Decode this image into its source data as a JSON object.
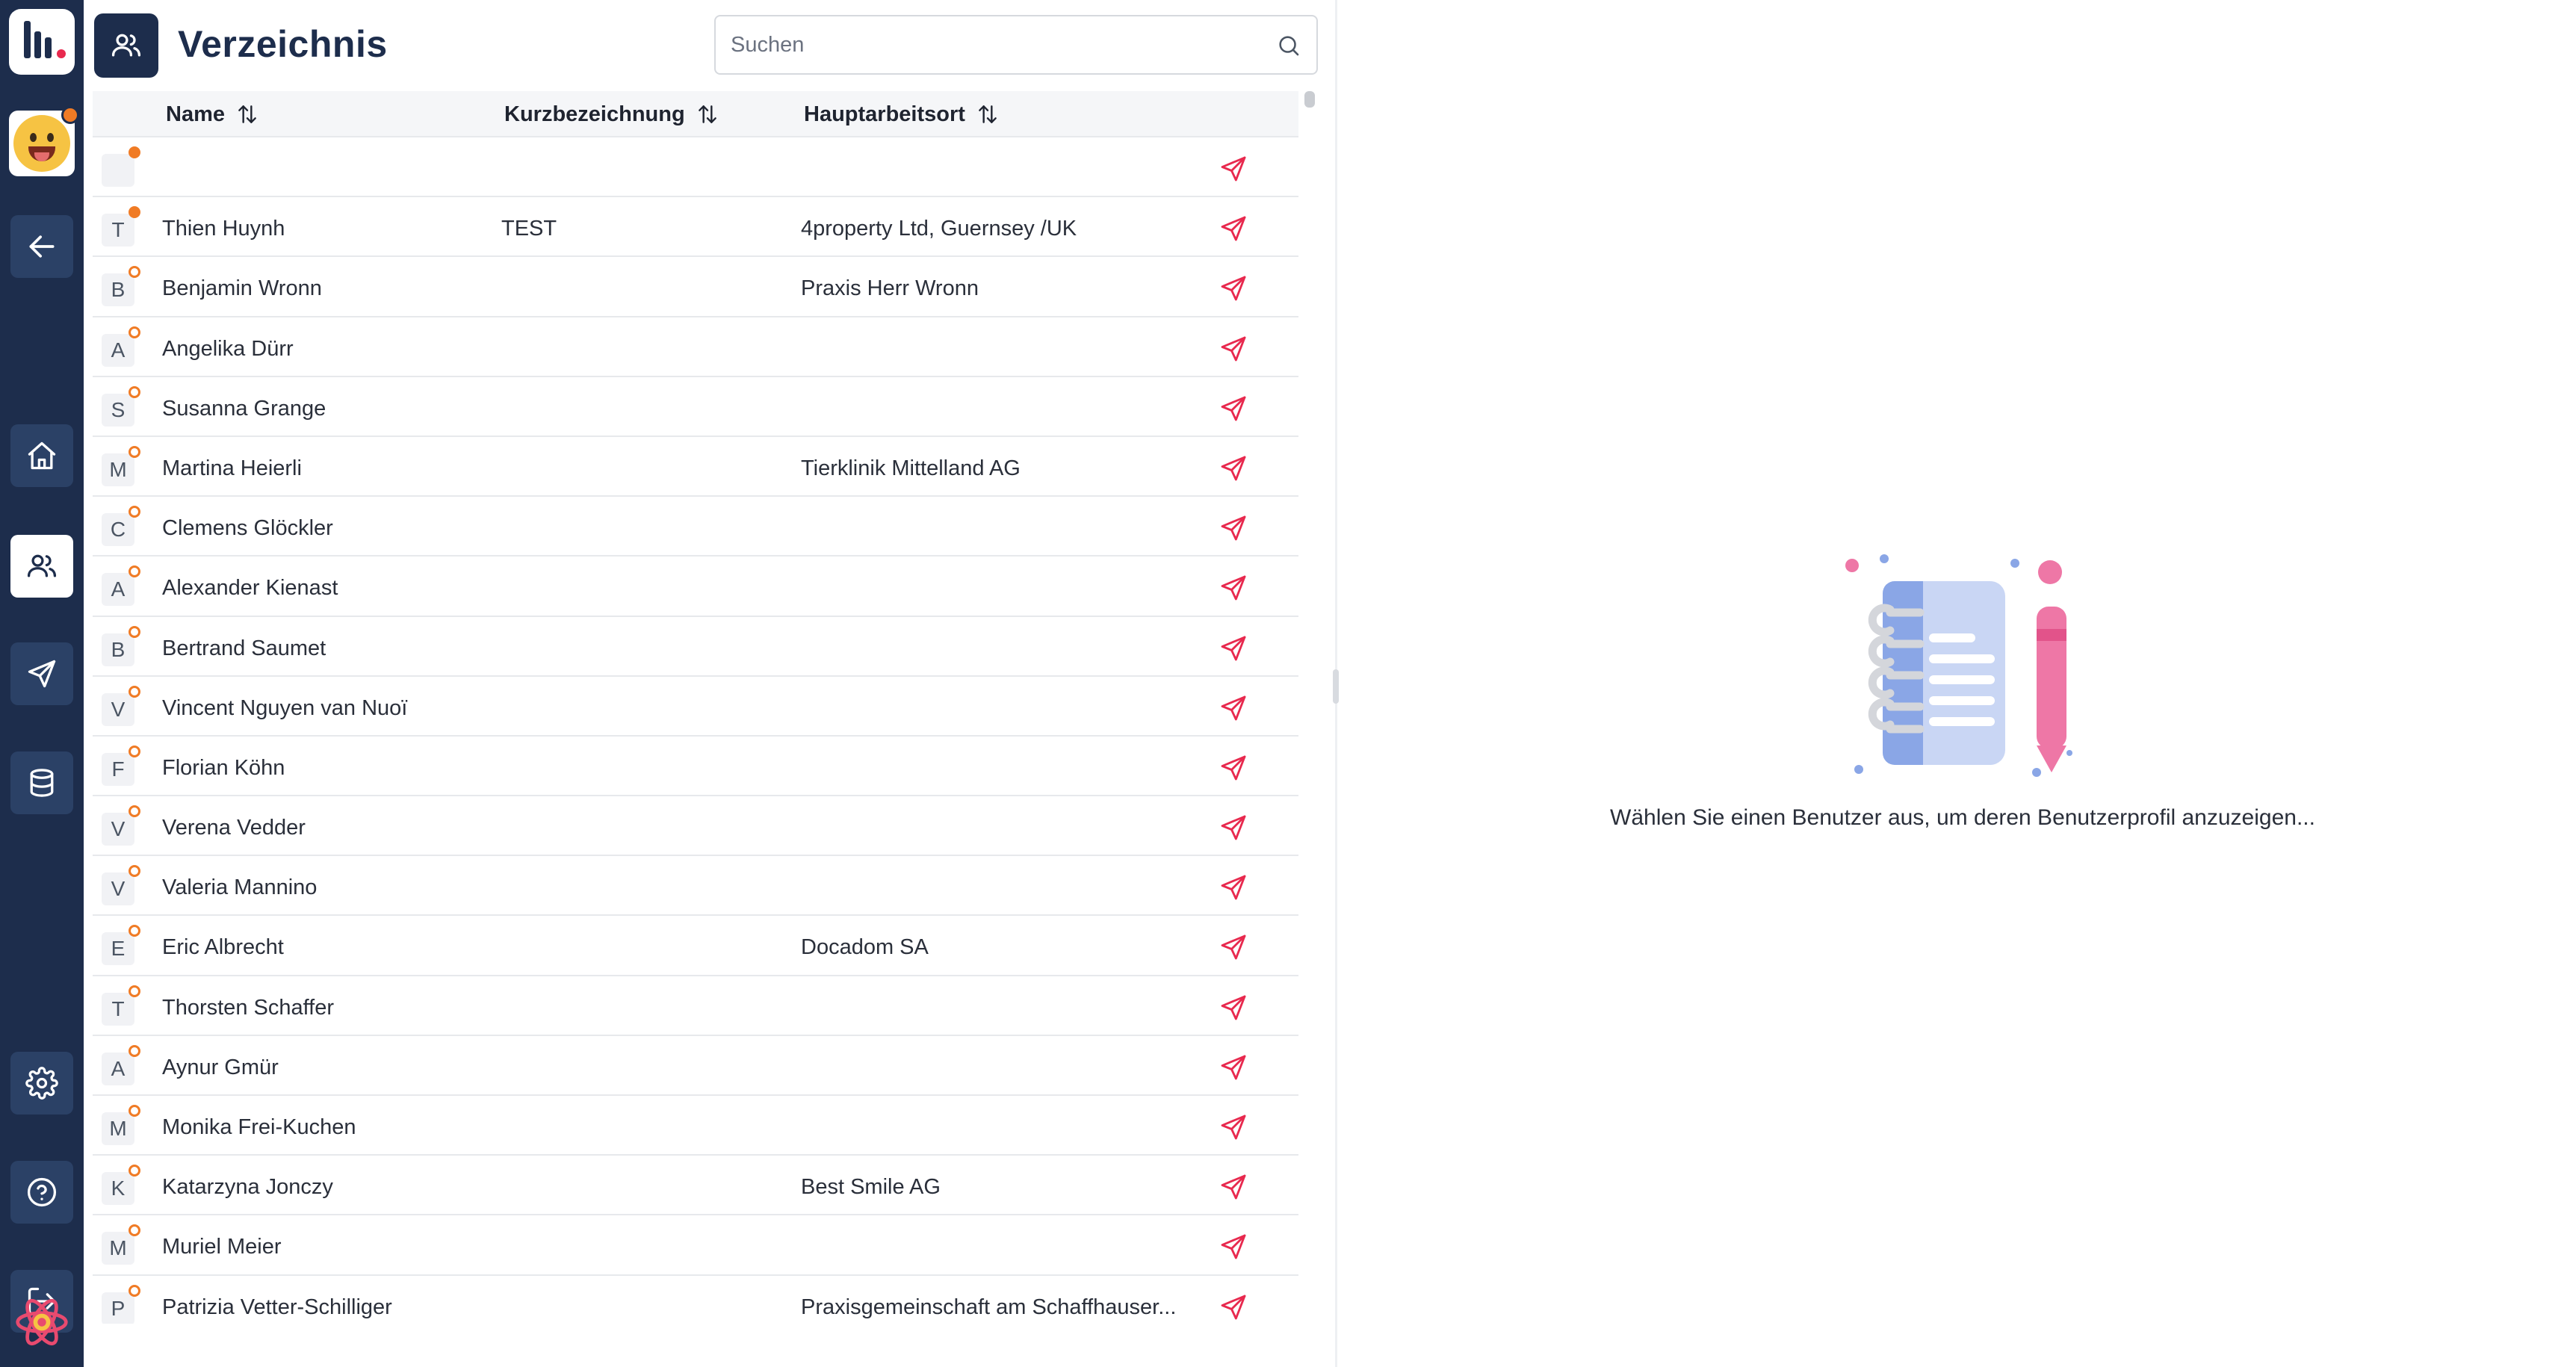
{
  "app": {
    "title": "Verzeichnis"
  },
  "search": {
    "placeholder": "Suchen",
    "value": ""
  },
  "columns": {
    "name": "Name",
    "short": "Kurzbezeichnung",
    "place": "Hauptarbeitsort"
  },
  "rows": [
    {
      "initial": "",
      "name": "",
      "short": "",
      "place": "",
      "online": true
    },
    {
      "initial": "T",
      "name": "Thien Huynh",
      "short": "TEST",
      "place": "4property Ltd, Guernsey /UK",
      "online": true
    },
    {
      "initial": "B",
      "name": "Benjamin Wronn",
      "short": "",
      "place": "Praxis Herr Wronn",
      "online": false
    },
    {
      "initial": "A",
      "name": "Angelika Dürr",
      "short": "",
      "place": "",
      "online": false
    },
    {
      "initial": "S",
      "name": "Susanna Grange",
      "short": "",
      "place": "",
      "online": false
    },
    {
      "initial": "M",
      "name": "Martina Heierli",
      "short": "",
      "place": "Tierklinik Mittelland AG",
      "online": false
    },
    {
      "initial": "C",
      "name": "Clemens Glöckler",
      "short": "",
      "place": "",
      "online": false
    },
    {
      "initial": "A",
      "name": "Alexander Kienast",
      "short": "",
      "place": "",
      "online": false
    },
    {
      "initial": "B",
      "name": "Bertrand Saumet",
      "short": "",
      "place": "",
      "online": false
    },
    {
      "initial": "V",
      "name": "Vincent Nguyen van Nuoï",
      "short": "",
      "place": "",
      "online": false
    },
    {
      "initial": "F",
      "name": "Florian Köhn",
      "short": "",
      "place": "",
      "online": false
    },
    {
      "initial": "V",
      "name": "Verena Vedder",
      "short": "",
      "place": "",
      "online": false
    },
    {
      "initial": "V",
      "name": "Valeria Mannino",
      "short": "",
      "place": "",
      "online": false
    },
    {
      "initial": "E",
      "name": "Eric Albrecht",
      "short": "",
      "place": "Docadom SA",
      "online": false
    },
    {
      "initial": "T",
      "name": "Thorsten Schaffer",
      "short": "",
      "place": "",
      "online": false
    },
    {
      "initial": "A",
      "name": "Aynur Gmür",
      "short": "",
      "place": "",
      "online": false
    },
    {
      "initial": "M",
      "name": "Monika Frei-Kuchen",
      "short": "",
      "place": "",
      "online": false
    },
    {
      "initial": "K",
      "name": "Katarzyna Jonczy",
      "short": "",
      "place": "Best Smile AG",
      "online": false
    },
    {
      "initial": "M",
      "name": "Muriel Meier",
      "short": "",
      "place": "",
      "online": false
    },
    {
      "initial": "P",
      "name": "Patrizia Vetter-Schilliger",
      "short": "",
      "place": "Praxisgemeinschaft am Schaffhauser...",
      "online": false
    }
  ],
  "empty_state": {
    "message": "Wählen Sie einen Benutzer aus, um deren Benutzerprofil anzuzeigen..."
  },
  "sidebar": {
    "items": [
      {
        "icon": "home-icon"
      },
      {
        "icon": "users-icon",
        "active": true
      },
      {
        "icon": "send-icon"
      },
      {
        "icon": "database-icon"
      },
      {
        "icon": "settings-icon"
      },
      {
        "icon": "help-icon"
      },
      {
        "icon": "logout-icon"
      }
    ]
  },
  "colors": {
    "sidebar": "#1d2d4c",
    "accent": "#e8294e",
    "status": "#f07b25"
  }
}
